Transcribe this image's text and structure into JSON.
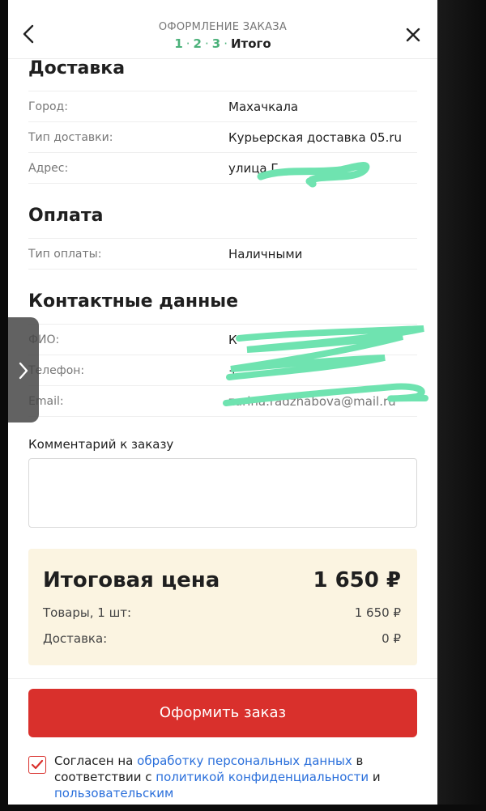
{
  "header": {
    "title": "ОФОРМЛЕНИЕ ЗАКАЗА",
    "steps": [
      "1",
      "2",
      "3"
    ],
    "final_step": "Итого"
  },
  "delivery": {
    "title": "Доставка",
    "rows": [
      {
        "label": "Город:",
        "value": "Махачкала"
      },
      {
        "label": "Тип доставки:",
        "value": "Курьерская доставка 05.ru"
      },
      {
        "label": "Адрес:",
        "value": "улица Г"
      }
    ]
  },
  "payment": {
    "title": "Оплата",
    "rows": [
      {
        "label": "Тип оплаты:",
        "value": "Наличными"
      }
    ]
  },
  "contacts": {
    "title": "Контактные данные",
    "rows": [
      {
        "label": "ФИО:",
        "value": "К"
      },
      {
        "label": "Телефон:",
        "value": "+"
      },
      {
        "label": "Email:",
        "value": "zarina.radzhabova@mail.ru"
      }
    ]
  },
  "comment": {
    "label": "Комментарий к заказу",
    "value": "",
    "placeholder": ""
  },
  "totals": {
    "title": "Итоговая цена",
    "price": "1 650 ₽",
    "goods_label": "Товары, 1 шт:",
    "goods_value": "1 650 ₽",
    "delivery_label": "Доставка:",
    "delivery_value": "0 ₽"
  },
  "order_button": "Оформить заказ",
  "consent": {
    "checked": true,
    "text_1": "Согласен на ",
    "link_1": "обработку персональных данных",
    "text_2": " в соответствии с ",
    "link_2": "политикой конфиденциальности",
    "text_3": " и ",
    "link_3": "пользовательским"
  },
  "colors": {
    "accent_red": "#d9302c",
    "step_green": "#4bb17a",
    "total_bg": "#fbf4e1",
    "link_blue": "#2a6fdb",
    "redaction_green": "#6fe3b0"
  },
  "icons": {
    "back": "chevron-left-icon",
    "close": "close-icon",
    "checkbox": "check-icon",
    "side_handle": "chevron-right-icon"
  }
}
